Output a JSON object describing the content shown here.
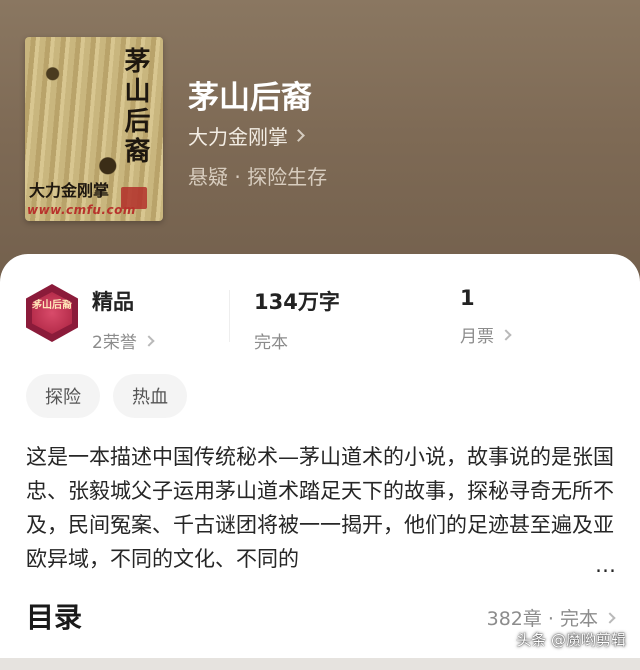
{
  "cover": {
    "title_vertical": "茅山后裔",
    "author": "大力金刚掌",
    "site": "www.cmfu.com"
  },
  "book": {
    "title": "茅山后裔",
    "author": "大力金刚掌",
    "genres": "悬疑 · 探险生存"
  },
  "stats": {
    "badge_text": "茅山后裔",
    "quality": {
      "value": "精品",
      "label": "2荣誉"
    },
    "words": {
      "value": "134万字",
      "label": "完本"
    },
    "tickets": {
      "value": "1",
      "label": "月票"
    }
  },
  "tags": [
    "探险",
    "热血"
  ],
  "description": "这是一本描述中国传统秘术—茅山道术的小说，故事说的是张国忠、张毅城父子运用茅山道术踏足天下的故事，探秘寻奇无所不及，民间冤案、千古谜团将被一一揭开，他们的足迹甚至遍及亚欧异域，不同的文化、不同的",
  "description_more": "…",
  "toc": {
    "title": "目录",
    "meta": "382章 · 完本"
  },
  "watermark": "头条 @魔哟剪辑",
  "colors": {
    "hero_bg": "#7e6a55",
    "badge": "#8b1b3a"
  }
}
